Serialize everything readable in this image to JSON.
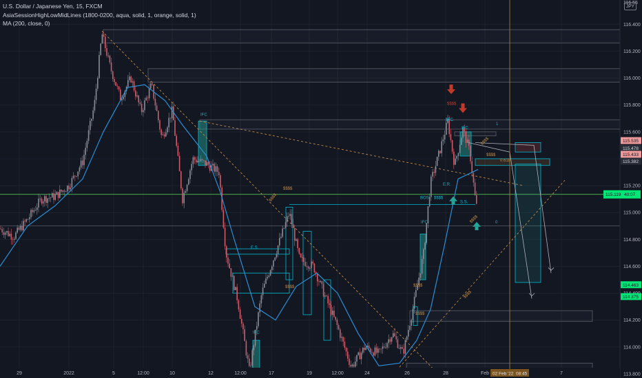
{
  "legend": {
    "symbol_line": "U.S. Dollar / Japanese Yen, 15, FXCM",
    "indicator1": "AsiaSessionHighLowMidLines (1800-0200, aqua, solid, 1, orange, solid, 1)",
    "indicator2": "MA (200, close, 0)"
  },
  "currency_badge": "JPY",
  "colors": {
    "background": "#131722",
    "grid": "#1e222d",
    "candle_up": "#8a8d96",
    "candle_down": "#d05c6a",
    "ma_line": "#2a8fd6",
    "session_box": "#5d606b",
    "aqua": "#00bcd4",
    "orange": "#c08a45",
    "green_line": "#4caf50",
    "arrow_red": "#c0392b",
    "arrow_teal": "#26a69a",
    "price_green": "#00e676",
    "price_red": "#ef9a9a"
  },
  "chart_data": {
    "type": "candlestick",
    "symbol": "USDJPY",
    "timeframe": "15",
    "ylim": [
      113.8,
      116.56
    ],
    "y_ticks": [
      "116.400",
      "116.200",
      "116.000",
      "115.800",
      "115.600",
      "115.400",
      "115.200",
      "115.000",
      "114.800",
      "114.600",
      "114.400",
      "114.200",
      "114.000",
      "113.800"
    ],
    "top_tick_label": "116.55",
    "x_ticks": [
      "29",
      "2022",
      "5",
      "12:00",
      "10",
      "12",
      "12:00",
      "17",
      "19",
      "12:00",
      "24",
      "26",
      "28",
      "Feb",
      "7"
    ],
    "crosshair_time_label": "02 Feb '22",
    "crosshair_time_suffix": "08:45",
    "crosshair_price_label": "115.119",
    "crosshair_price_suffix": "40:07",
    "price_tags": [
      {
        "label": "115.535",
        "style": "red"
      },
      {
        "label": "115.478",
        "style": "dark"
      },
      {
        "label": "115.433",
        "style": "red"
      },
      {
        "label": "115.382",
        "style": "dark"
      },
      {
        "label": "114.463",
        "style": "green"
      },
      {
        "label": "114.375",
        "style": "green"
      }
    ],
    "path_keypoints": [
      {
        "x": 0,
        "y": 114.88
      },
      {
        "x": 20,
        "y": 114.82
      },
      {
        "x": 40,
        "y": 114.95
      },
      {
        "x": 60,
        "y": 115.1
      },
      {
        "x": 80,
        "y": 115.12
      },
      {
        "x": 100,
        "y": 115.2
      },
      {
        "x": 120,
        "y": 115.38
      },
      {
        "x": 137,
        "y": 115.8
      },
      {
        "x": 148,
        "y": 116.33
      },
      {
        "x": 160,
        "y": 116.08
      },
      {
        "x": 175,
        "y": 115.85
      },
      {
        "x": 190,
        "y": 116.0
      },
      {
        "x": 205,
        "y": 115.75
      },
      {
        "x": 220,
        "y": 115.95
      },
      {
        "x": 235,
        "y": 115.55
      },
      {
        "x": 250,
        "y": 115.76
      },
      {
        "x": 265,
        "y": 115.1
      },
      {
        "x": 280,
        "y": 115.4
      },
      {
        "x": 300,
        "y": 115.36
      },
      {
        "x": 318,
        "y": 115.3
      },
      {
        "x": 328,
        "y": 114.7
      },
      {
        "x": 345,
        "y": 114.35
      },
      {
        "x": 362,
        "y": 113.82
      },
      {
        "x": 380,
        "y": 114.4
      },
      {
        "x": 400,
        "y": 114.7
      },
      {
        "x": 420,
        "y": 115.0
      },
      {
        "x": 435,
        "y": 114.65
      },
      {
        "x": 455,
        "y": 114.6
      },
      {
        "x": 470,
        "y": 114.4
      },
      {
        "x": 490,
        "y": 114.15
      },
      {
        "x": 510,
        "y": 113.85
      },
      {
        "x": 530,
        "y": 114.0
      },
      {
        "x": 550,
        "y": 113.95
      },
      {
        "x": 570,
        "y": 114.1
      },
      {
        "x": 585,
        "y": 113.95
      },
      {
        "x": 600,
        "y": 114.3
      },
      {
        "x": 615,
        "y": 114.7
      },
      {
        "x": 625,
        "y": 115.22
      },
      {
        "x": 638,
        "y": 115.45
      },
      {
        "x": 650,
        "y": 115.68
      },
      {
        "x": 660,
        "y": 115.35
      },
      {
        "x": 672,
        "y": 115.62
      },
      {
        "x": 682,
        "y": 115.45
      },
      {
        "x": 690,
        "y": 115.1
      },
      {
        "x": 694,
        "y": 114.98
      }
    ],
    "ma_keypoints": [
      {
        "x": 0,
        "y": 114.6
      },
      {
        "x": 40,
        "y": 114.9
      },
      {
        "x": 80,
        "y": 115.05
      },
      {
        "x": 120,
        "y": 115.25
      },
      {
        "x": 150,
        "y": 115.6
      },
      {
        "x": 185,
        "y": 115.93
      },
      {
        "x": 210,
        "y": 115.95
      },
      {
        "x": 240,
        "y": 115.83
      },
      {
        "x": 265,
        "y": 115.65
      },
      {
        "x": 300,
        "y": 115.42
      },
      {
        "x": 320,
        "y": 115.15
      },
      {
        "x": 340,
        "y": 114.8
      },
      {
        "x": 370,
        "y": 114.3
      },
      {
        "x": 400,
        "y": 114.2
      },
      {
        "x": 430,
        "y": 114.45
      },
      {
        "x": 460,
        "y": 114.55
      },
      {
        "x": 490,
        "y": 114.4
      },
      {
        "x": 520,
        "y": 114.1
      },
      {
        "x": 550,
        "y": 113.86
      },
      {
        "x": 580,
        "y": 113.88
      },
      {
        "x": 605,
        "y": 114.05
      },
      {
        "x": 625,
        "y": 114.28
      },
      {
        "x": 645,
        "y": 114.75
      },
      {
        "x": 665,
        "y": 115.25
      },
      {
        "x": 694,
        "y": 115.32
      }
    ],
    "annotations": [
      {
        "text": "IFC",
        "kind": "aqua"
      },
      {
        "text": "$$$$",
        "kind": "orange"
      },
      {
        "text": "E.S.",
        "kind": "aqua"
      },
      {
        "text": "BOS",
        "kind": "aqua"
      },
      {
        "text": "$$$$",
        "kind": "orange"
      },
      {
        "text": "IFC",
        "kind": "aqua"
      },
      {
        "text": "$$$$",
        "kind": "orange"
      },
      {
        "text": "$$$$",
        "kind": "orange"
      },
      {
        "text": "$$$$",
        "kind": "red"
      },
      {
        "text": "IFC",
        "kind": "aqua"
      },
      {
        "text": "E.R.",
        "kind": "aqua"
      },
      {
        "text": "$$$$",
        "kind": "aqua"
      },
      {
        "text": "S.S.",
        "kind": "aqua"
      },
      {
        "text": "$$$$",
        "kind": "orange"
      },
      {
        "text": "IFC",
        "kind": "aqua"
      },
      {
        "text": "1",
        "kind": "aqua"
      },
      {
        "text": "0",
        "kind": "aqua"
      },
      {
        "text": "$$$$",
        "kind": "orange"
      },
      {
        "text": "$$$$",
        "kind": "orange"
      },
      {
        "text": "0.618",
        "kind": "orange"
      },
      {
        "text": "$$$$",
        "kind": "orange"
      },
      {
        "text": "$$$$",
        "kind": "orange"
      },
      {
        "text": "IFC",
        "kind": "aqua"
      }
    ]
  }
}
